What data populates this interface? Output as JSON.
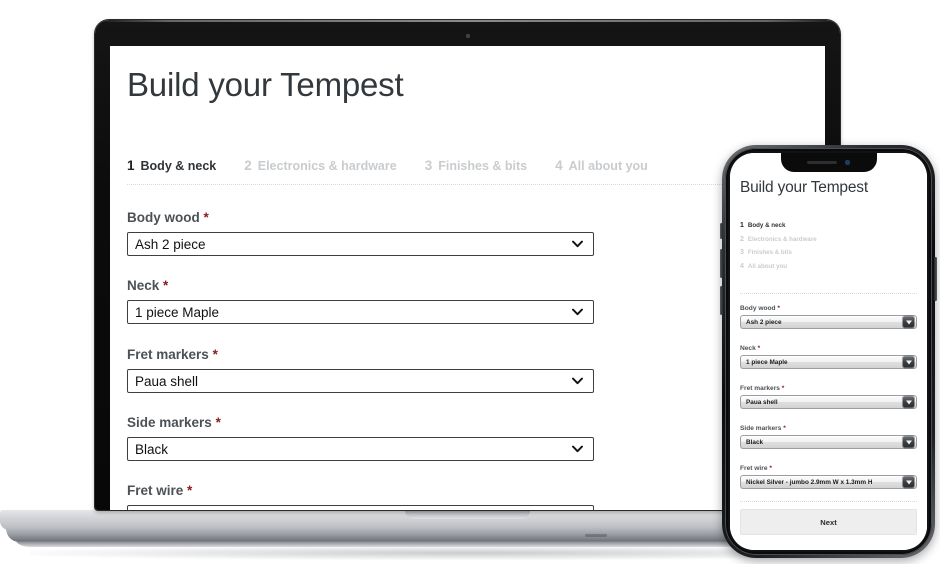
{
  "page": {
    "title": "Build your Tempest",
    "steps": [
      {
        "num": "1",
        "label": "Body & neck",
        "state": "active"
      },
      {
        "num": "2",
        "label": "Electronics & hardware",
        "state": "inactive"
      },
      {
        "num": "3",
        "label": "Finishes & bits",
        "state": "inactive"
      },
      {
        "num": "4",
        "label": "All about you",
        "state": "inactive"
      }
    ],
    "required_marker": "*",
    "fields": [
      {
        "label": "Body wood",
        "value": "Ash 2 piece"
      },
      {
        "label": "Neck",
        "value": "1 piece Maple"
      },
      {
        "label": "Fret markers",
        "value": "Paua shell"
      },
      {
        "label": "Side markers",
        "value": "Black"
      },
      {
        "label": "Fret wire",
        "value": "Nickel Silver - jumbo 2.9mm W x 1.3mm H"
      }
    ],
    "next_label": "Next"
  },
  "devices": {
    "laptop": {
      "name": "laptop",
      "icon": "webcam-dot"
    },
    "phone": {
      "name": "smartphone",
      "icon": "notch-speaker-camera"
    }
  },
  "colors": {
    "required_asterisk": "#8a1c22",
    "label_text": "#4c5155",
    "active_step": "#2f3337",
    "inactive_step": "#c9cccf",
    "title_text": "#33383c",
    "select_border": "#3c3f43",
    "next_button_bg": "#eeeeee",
    "screen_bg": "#ffffff"
  }
}
